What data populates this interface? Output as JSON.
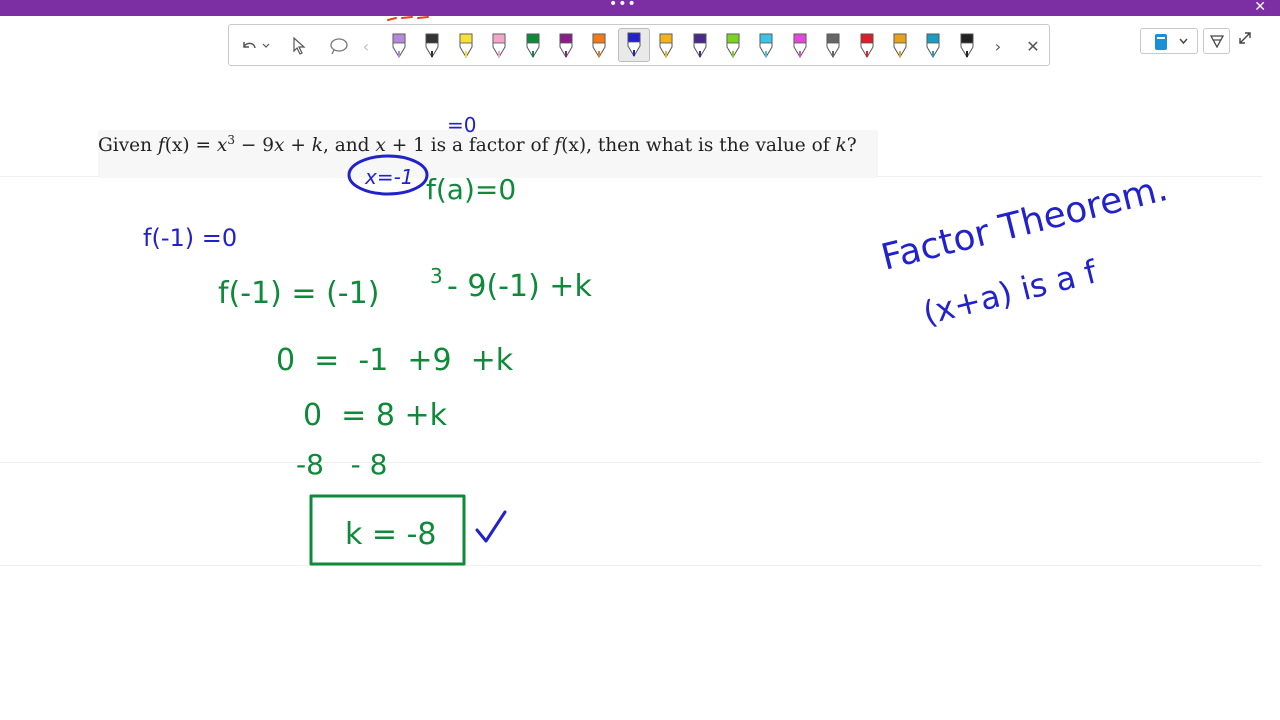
{
  "titlebar": {
    "menu_label": "•••",
    "close_label": "✕"
  },
  "toolbar": {
    "undo_icon": "undo-icon",
    "back_label": "‹",
    "next_label": "›",
    "close_label": "✕",
    "pens": [
      {
        "name": "highlighter-purple",
        "color": "#b48ad8"
      },
      {
        "name": "text-pen",
        "color": "#333333"
      },
      {
        "name": "highlighter-yellow",
        "color": "#f6e13a"
      },
      {
        "name": "highlighter-pink",
        "color": "#f2a6c8"
      },
      {
        "name": "pen-green",
        "color": "#0e8a3a"
      },
      {
        "name": "pen-purple",
        "color": "#8a1f8a"
      },
      {
        "name": "pen-orange",
        "color": "#f07a1c"
      },
      {
        "name": "pen-blue-selected",
        "color": "#2222cc"
      },
      {
        "name": "pen-gold",
        "color": "#f2b21c"
      },
      {
        "name": "pen-indigo",
        "color": "#4a2a8a"
      },
      {
        "name": "pen-lime",
        "color": "#7ad321"
      },
      {
        "name": "pen-cyan",
        "color": "#3cc3e6"
      },
      {
        "name": "pen-magenta",
        "color": "#e04ad8"
      },
      {
        "name": "pen-gray",
        "color": "#666666"
      },
      {
        "name": "pen-red",
        "color": "#d81f2a"
      },
      {
        "name": "pen-rainbow",
        "color": "#e6a21c"
      },
      {
        "name": "ruler-tool",
        "color": "#1c9cc0"
      },
      {
        "name": "pen-black",
        "color": "#222222"
      }
    ]
  },
  "question": {
    "p1": "Given ",
    "f": "f",
    "x_paren": "(x)",
    "eq": " = ",
    "x3": "x",
    "exp": "3",
    "minus": " − 9",
    "x2": "x",
    "plus_k": " + ",
    "k": "k",
    "and": ", and ",
    "x4": "x",
    "plus1": " + 1 is a factor of ",
    "f2": "f",
    "x_paren2": "(x)",
    "rest": ", then what is the value of ",
    "k2": "k",
    "qmark": "?"
  },
  "handwriting": {
    "eq_zero": "=0",
    "x_eq": "x=-1",
    "fa": "f(a)=0",
    "f_neg1": "f(-1) =0",
    "line1": "f(-1) = (-1)",
    "line1_exp": "3",
    "line1_rest": "- 9(-1) +k",
    "line2": "0  =  -1  +9  +k",
    "line3": "0  = 8 +k",
    "line4": "-8   - 8",
    "answer": "k = -8",
    "check": "✓",
    "theorem_title": "Factor Theorem.",
    "theorem_body": "(x+a) is a f"
  },
  "colors": {
    "green_ink": "#0e8a3a",
    "blue_ink": "#2222cc",
    "topbar": "#7b2fa3"
  }
}
